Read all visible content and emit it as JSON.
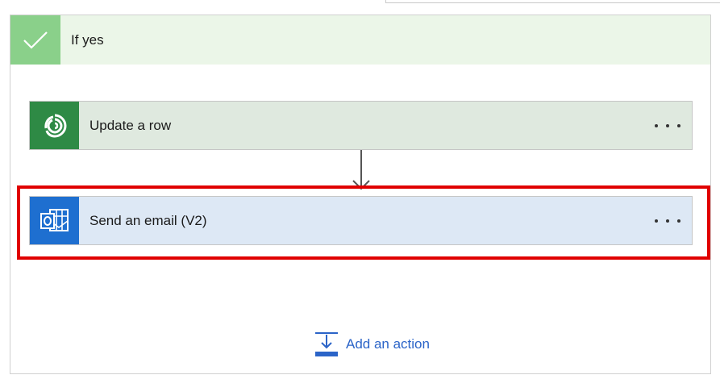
{
  "branch": {
    "title": "If yes",
    "icon": "checkmark-icon",
    "header_color": "#ebf6e8",
    "check_color": "#8ad08a"
  },
  "actions": [
    {
      "title": "Update a row",
      "icon": "dataverse-icon",
      "color": "#2e8a45",
      "card_bg": "#dfe9df",
      "menu": "more-options-icon"
    },
    {
      "title": "Send an email (V2)",
      "icon": "outlook-icon",
      "color": "#1e6fd0",
      "card_bg": "#dde8f5",
      "menu": "more-options-icon"
    }
  ],
  "add_action": {
    "label": "Add an action",
    "icon": "add-action-icon",
    "color": "#2b64c8"
  },
  "highlight_color": "#e00000"
}
